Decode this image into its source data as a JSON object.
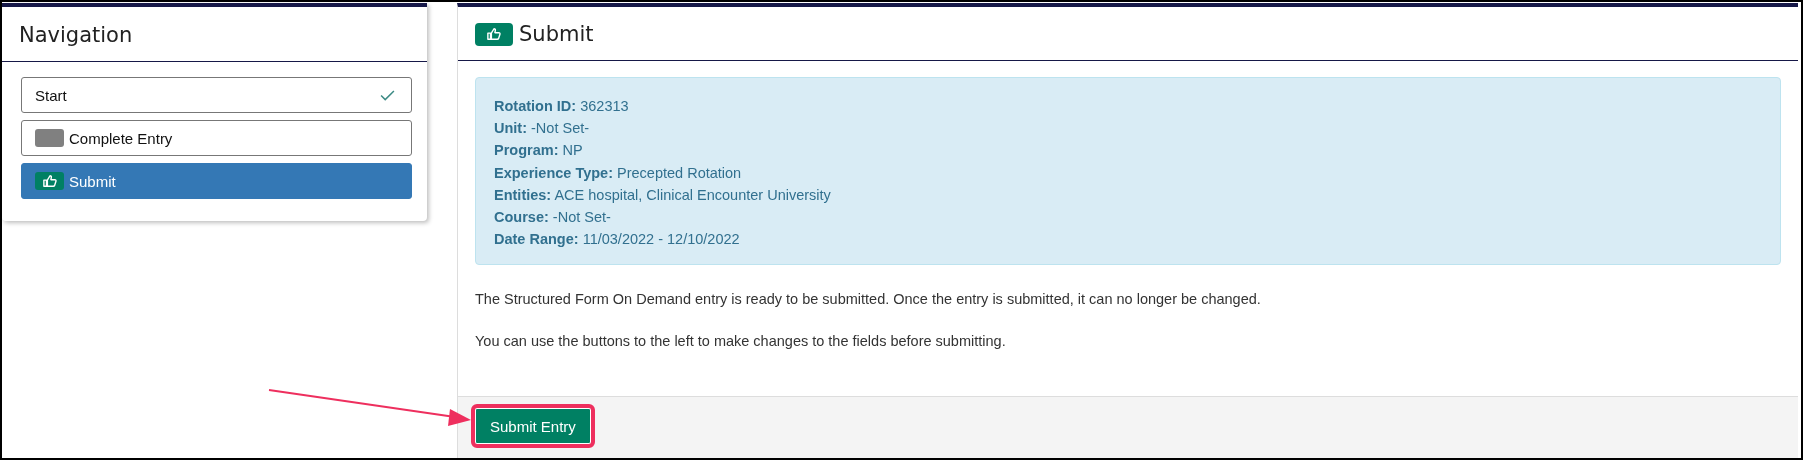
{
  "navigation": {
    "title": "Navigation",
    "items": [
      {
        "label": "Start",
        "kind": "done",
        "selected": false
      },
      {
        "label": "Complete Entry",
        "kind": "pending",
        "selected": false
      },
      {
        "label": "Submit",
        "kind": "submit",
        "selected": true
      }
    ]
  },
  "main": {
    "title": "Submit",
    "details": [
      {
        "label": "Rotation ID:",
        "value": "362313"
      },
      {
        "label": "Unit:",
        "value": "-Not Set-"
      },
      {
        "label": "Program:",
        "value": "NP"
      },
      {
        "label": "Experience Type:",
        "value": "Precepted Rotation"
      },
      {
        "label": "Entities:",
        "value": "ACE hospital, Clinical Encounter University"
      },
      {
        "label": "Course:",
        "value": "-Not Set-"
      },
      {
        "label": "Date Range:",
        "value": "11/03/2022 - 12/10/2022"
      }
    ],
    "paragraphs": [
      "The Structured Form On Demand entry is ready to be submitted. Once the entry is submitted, it can no longer be changed.",
      "You can use the buttons to the left to make changes to the fields before submitting."
    ],
    "submit_button": {
      "label": "Submit Entry",
      "highlighted": true
    }
  },
  "annotation": {
    "kind": "arrow"
  }
}
